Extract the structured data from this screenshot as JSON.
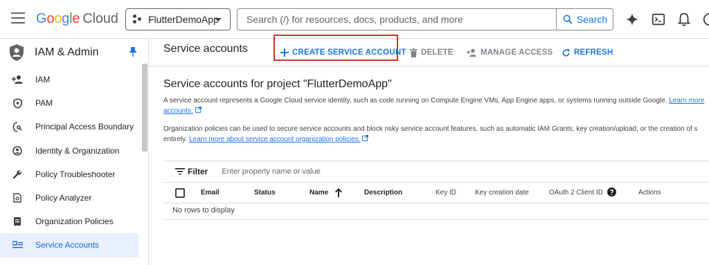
{
  "header": {
    "logo": {
      "g1": "G",
      "g2": "o",
      "g3": "o",
      "g4": "g",
      "g5": "l",
      "g6": "e",
      "cloud": "Cloud"
    },
    "project": "FlutterDemoApp",
    "search_placeholder": "Search (/) for resources, docs, products, and more",
    "search_button": "Search",
    "icons": [
      "gemini-icon",
      "cloud-shell-icon",
      "notifications-icon",
      "help-icon"
    ]
  },
  "sidebar": {
    "title": "IAM & Admin",
    "items": [
      {
        "label": "IAM",
        "icon": "person-add-icon"
      },
      {
        "label": "PAM",
        "icon": "shield-icon"
      },
      {
        "label": "Principal Access Boundary",
        "icon": "boundary-icon"
      },
      {
        "label": "Identity & Organization",
        "icon": "account-circle-icon"
      },
      {
        "label": "Policy Troubleshooter",
        "icon": "wrench-icon"
      },
      {
        "label": "Policy Analyzer",
        "icon": "analyzer-icon"
      },
      {
        "label": "Organization Policies",
        "icon": "document-icon"
      },
      {
        "label": "Service Accounts",
        "icon": "service-account-icon",
        "active": true
      }
    ]
  },
  "actionbar": {
    "title": "Service accounts",
    "create": "CREATE SERVICE ACCOUNT",
    "delete": "DELETE",
    "manage": "MANAGE ACCESS",
    "refresh": "REFRESH"
  },
  "main": {
    "heading": "Service accounts for project \"FlutterDemoApp\"",
    "para1_text": "A service account represents a Google Cloud service identity, such as code running on Compute Engine VMs, App Engine apps, or systems running outside Google.",
    "para1_link": "Learn more",
    "para1_link2": "accounts.",
    "para2_text": "Organization policies can be used to secure service accounts and block risky service account features, such as automatic IAM Grants, key creation/upload, or the creation of s",
    "para2_line2": "entirely.",
    "para2_link": "Learn more about service account organization policies.",
    "filter_label": "Filter",
    "filter_placeholder": "Enter property name or value",
    "columns": [
      "Email",
      "Status",
      "Name",
      "Description",
      "Key ID",
      "Key creation date",
      "OAuth 2 Client ID",
      "Actions"
    ],
    "empty": "No rows to display"
  },
  "colors": {
    "accent": "#1a73e8",
    "highlight": "#d93025",
    "active_bg": "#e8f0fe"
  }
}
